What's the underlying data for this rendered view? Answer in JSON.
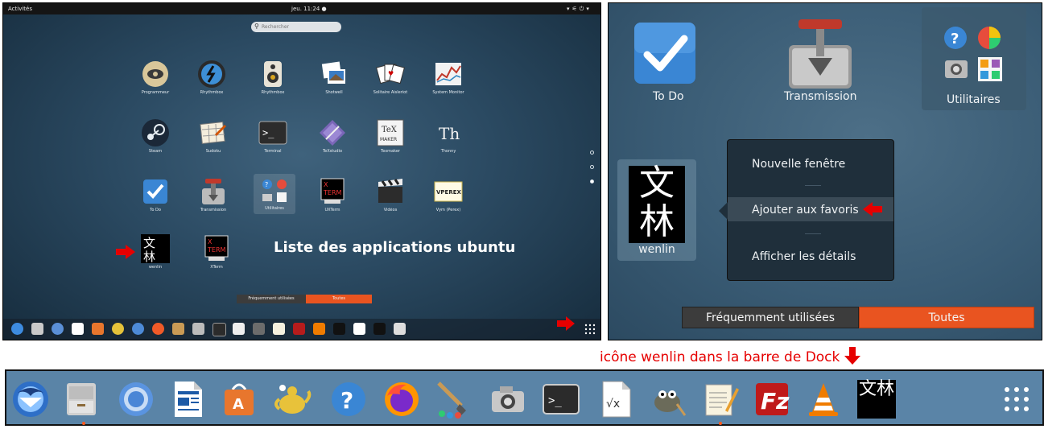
{
  "left_panel": {
    "topbar": {
      "activities": "Activités",
      "clock": "jeu. 11:24 ●"
    },
    "search": {
      "placeholder": "Rechercher"
    },
    "apps": [
      {
        "label": "Programmeur",
        "icon": "phone-icon"
      },
      {
        "label": "Rhythmbox",
        "icon": "rhythmbox-icon"
      },
      {
        "label": "Rhythmbox",
        "icon": "speaker-icon"
      },
      {
        "label": "Shotwell",
        "icon": "photos-icon"
      },
      {
        "label": "Solitaire Aisleriot",
        "icon": "cards-icon"
      },
      {
        "label": "System Monitor",
        "icon": "monitor-chart-icon"
      },
      {
        "label": "Steam",
        "icon": "steam-icon"
      },
      {
        "label": "Sudoku",
        "icon": "sudoku-icon"
      },
      {
        "label": "Terminal",
        "icon": "terminal-icon"
      },
      {
        "label": "TeXstudio",
        "icon": "texstudio-icon"
      },
      {
        "label": "Texmaker",
        "icon": "texmaker-icon"
      },
      {
        "label": "Thonny",
        "icon": "thonny-icon"
      },
      {
        "label": "To Do",
        "icon": "todo-icon"
      },
      {
        "label": "Transmission",
        "icon": "transmission-icon"
      },
      {
        "label": "Utilitaires",
        "icon": "utilities-folder-icon"
      },
      {
        "label": "UXTerm",
        "icon": "uxterm-icon"
      },
      {
        "label": "Vidéos",
        "icon": "videos-icon"
      },
      {
        "label": "Vym (Perex)",
        "icon": "vym-icon"
      },
      {
        "label": "wenlin",
        "icon": "wenlin-icon"
      },
      {
        "label": "XTerm",
        "icon": "xterm-icon"
      }
    ],
    "caption": "Liste des applications ubuntu",
    "tabs": {
      "frequent": "Fréquemment utilisées",
      "all": "Toutes"
    }
  },
  "right_panel": {
    "apps": {
      "todo": "To Do",
      "transmission": "Transmission",
      "utilities": "Utilitaires",
      "wenlin": "wenlin"
    },
    "wenlin_glyphs": "文林",
    "context_menu": {
      "new_window": "Nouvelle fenêtre",
      "add_favorite": "Ajouter aux favoris",
      "details": "Afficher les détails"
    },
    "tabs": {
      "frequent": "Fréquemment utilisées",
      "all": "Toutes"
    }
  },
  "dock_caption": "icône wenlin dans la barre de Dock",
  "dock_items": [
    "thunderbird-icon",
    "files-icon",
    "chromium-icon",
    "libreoffice-writer-icon",
    "software-center-icon",
    "teapot-icon",
    "help-icon",
    "firefox-icon",
    "paintbrush-icon",
    "camera-icon",
    "terminal-icon",
    "libreoffice-math-icon",
    "gimp-icon",
    "text-editor-icon",
    "filezilla-icon",
    "vlc-icon",
    "wenlin-icon",
    "show-apps-icon"
  ],
  "colors": {
    "accent_orange": "#e95420",
    "arrow_red": "#e60000"
  }
}
